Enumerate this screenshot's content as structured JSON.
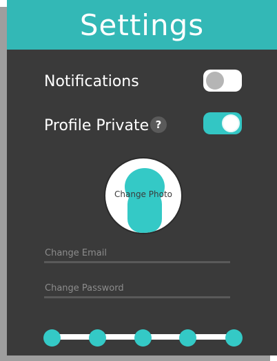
{
  "header": {
    "title": "Settings"
  },
  "settings": {
    "notifications": {
      "label": "Notifications",
      "enabled": false
    },
    "profile_private": {
      "label": "Profile Private",
      "help_glyph": "?",
      "enabled": true
    }
  },
  "photo": {
    "label": "Change Photo"
  },
  "fields": {
    "email": {
      "placeholder": "Change Email",
      "value": ""
    },
    "password": {
      "placeholder": "Change Password",
      "value": ""
    }
  },
  "stepper": {
    "steps": 5
  },
  "colors": {
    "accent": "#33b8b6",
    "panel": "#3a3a3a",
    "toggle_on": "#33c6c4",
    "toggle_off_knob": "#b5b5b5"
  }
}
